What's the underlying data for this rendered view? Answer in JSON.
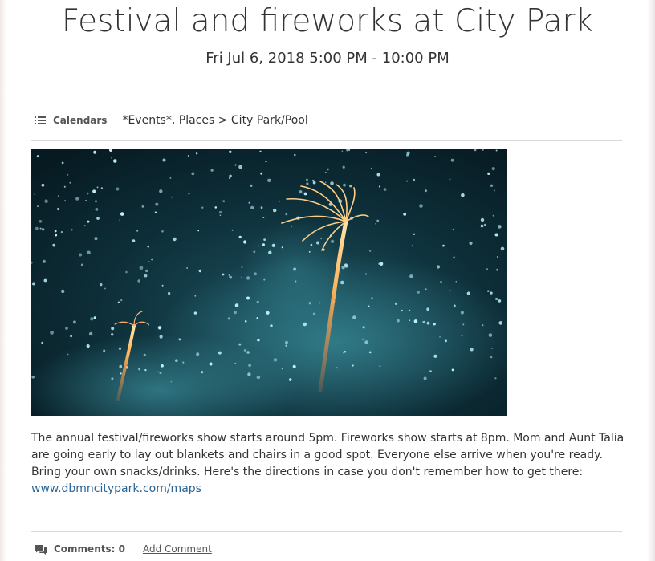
{
  "event": {
    "title": "Festival and fireworks at City Park",
    "datetime": "Fri Jul 6, 2018 5:00 PM - 10:00 PM"
  },
  "calendars": {
    "label": "Calendars",
    "value": "*Events*, Places > City Park/Pool",
    "icon": "list-icon"
  },
  "image": {
    "description": "fireworks-photo"
  },
  "description": {
    "text": "The annual festival/fireworks show starts around 5pm. Fireworks show starts at 8pm. Mom and Aunt Talia are going early to lay out blankets and chairs in a good spot. Everyone else arrive when you're ready. Bring your own snacks/drinks. Here's the directions in case you don't remember how to get there:",
    "link": "www.dbmncitypark.com/maps"
  },
  "footer": {
    "comments_label": "Comments: 0",
    "add_comment": "Add Comment",
    "icon": "comments-icon"
  }
}
